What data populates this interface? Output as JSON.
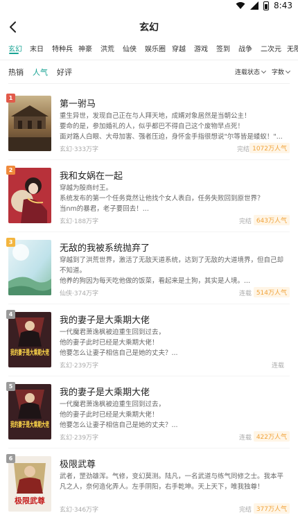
{
  "status_bar": {
    "time": "8:43"
  },
  "nav": {
    "title": "玄幻"
  },
  "categories": [
    {
      "label": "玄幻",
      "active": true
    },
    {
      "label": "末日"
    },
    {
      "label": "特种兵"
    },
    {
      "label": "神豪"
    },
    {
      "label": "洪荒"
    },
    {
      "label": "仙侠"
    },
    {
      "label": "娱乐圈"
    },
    {
      "label": "穿越"
    },
    {
      "label": "游戏"
    },
    {
      "label": "签到"
    },
    {
      "label": "战争"
    },
    {
      "label": "二次元"
    },
    {
      "label": "无限"
    }
  ],
  "sort_tabs": [
    {
      "label": "热销"
    },
    {
      "label": "人气",
      "active": true
    },
    {
      "label": "好评"
    }
  ],
  "filters": {
    "serial_status": "连载状态",
    "word_count": "字数"
  },
  "accent_color": "#17a393",
  "books": [
    {
      "rank": "1",
      "rank_color": "#e25a4a",
      "title": "第一驸马",
      "desc": "重生异世，发现自己正在与人拜天地，成婿对象居然是当朝公主！\n   要命的是，参加婚礼的人，似乎都巴不得自己这个废物早点死！\n   面对路人白眼、大母加害、强者压迫，身怀金手指很想说\"尔等皆是蝼蚁！\"...",
      "meta": "玄幻·333万字",
      "status": "完结",
      "popularity": "1072万人气"
    },
    {
      "rank": "2",
      "rank_color": "#f08a3c",
      "title": "我和女娲在一起",
      "desc": "穿越为殷商纣王。\n系统发布的第一个任务竟然让他找个女人表白，任务失败回到原世界？\n当nm的暴君，老子要回去！...",
      "meta": "玄幻·188万字",
      "status": "完结",
      "popularity": "643万人气"
    },
    {
      "rank": "3",
      "rank_color": "#f3b53f",
      "title": "无敌的我被系统抛弃了",
      "desc": "穿越到了洪荒世界，激活了无敌天道系统，达到了无敌的大道境界，但自己却不知道。\n他养的狗因为每天吃他做的饭菜，看起来是土狗，其实是人境。...",
      "meta": "仙侠·374万字",
      "status": "连载",
      "popularity": "514万人气"
    },
    {
      "rank": "4",
      "rank_color": "#9a9a9a",
      "title": "我的妻子是大乘期大佬",
      "desc": "   一代魔君萧逸枫被迫重生回到过去，\n   他的妻子此时已经是大乘期大佬！\n   他要怎么让妻子相信自己是她的丈夫？...",
      "meta": "玄幻·239万字",
      "status": "连载",
      "popularity": ""
    },
    {
      "rank": "5",
      "rank_color": "#9a9a9a",
      "title": "我的妻子是大乘期大佬",
      "desc": "   一代魔君萧逸枫被迫重生回到过去，\n   他的妻子此时已经是大乘期大佬！\n   他要怎么让妻子相信自己是她的丈夫？...",
      "meta": "玄幻·239万字",
      "status": "连载",
      "popularity": "422万人气"
    },
    {
      "rank": "6",
      "rank_color": "#9a9a9a",
      "title": "极限武尊",
      "desc": "武者，罡劲雄浑。气修，变幻莫测。陆凡，一名武道与练气同修之士。我本平凡之人，奈何造化弄人。左手阴阳，右手乾坤。天上天下，唯我独尊！",
      "meta": "玄幻·346万字",
      "status": "完结",
      "popularity": "377万人气"
    }
  ],
  "cover_texts": {
    "cover4": "我的妻子是大乘期大佬",
    "cover5": "我的妻子是大乘期大佬",
    "cover6": "极限武尊"
  }
}
